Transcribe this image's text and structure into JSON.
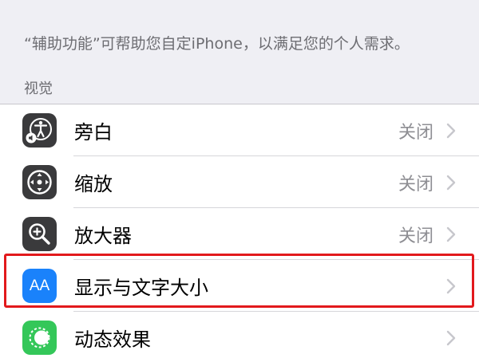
{
  "description": "“辅助功能”可帮助您自定iPhone，以满足您的个人需求。",
  "section_header": "视觉",
  "colors": {
    "icon_dark": "#3a3a3c",
    "icon_blue": "#1a82fb",
    "icon_green": "#34c759",
    "highlight": "#e2191c",
    "value_gray": "#8e8e93"
  },
  "rows": [
    {
      "label": "旁白",
      "value": "关闭",
      "icon": "voiceover-icon"
    },
    {
      "label": "缩放",
      "value": "关闭",
      "icon": "zoom-icon"
    },
    {
      "label": "放大器",
      "value": "关闭",
      "icon": "magnifier-icon"
    },
    {
      "label": "显示与文字大小",
      "value": "",
      "icon": "text-size-icon",
      "icon_text": "AA"
    },
    {
      "label": "动态效果",
      "value": "",
      "icon": "motion-icon"
    }
  ]
}
